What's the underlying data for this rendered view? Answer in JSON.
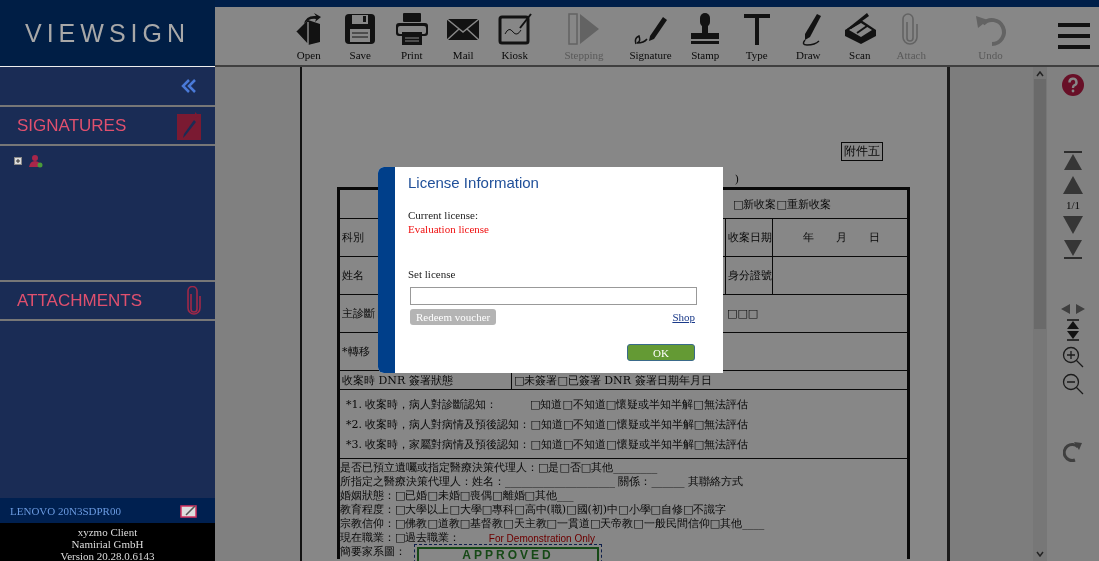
{
  "logo": {
    "text": "VIEWSIGN"
  },
  "sidebar": {
    "sections": [
      {
        "kind": "signatures",
        "title": "SIGNATURES"
      },
      {
        "kind": "attachments",
        "title": "ATTACHMENTS"
      }
    ],
    "tree": [
      {
        "expanded": false
      }
    ],
    "device": "LENOVO 20N3SDPR00",
    "footer": [
      "xyzmo Client",
      "Namirial GmbH",
      "Version 20.28.0.6143"
    ]
  },
  "toolbar": [
    {
      "kind": "open",
      "label": "Open",
      "disabled": false
    },
    {
      "kind": "save",
      "label": "Save",
      "disabled": false
    },
    {
      "kind": "print",
      "label": "Print",
      "disabled": false
    },
    {
      "kind": "mail",
      "label": "Mail",
      "disabled": false
    },
    {
      "kind": "kiosk",
      "label": "Kiosk",
      "disabled": false
    },
    {
      "kind": "stepping",
      "label": "Stepping",
      "disabled": true
    },
    {
      "kind": "signature",
      "label": "Signature",
      "disabled": false
    },
    {
      "kind": "stamp",
      "label": "Stamp",
      "disabled": false
    },
    {
      "kind": "type",
      "label": "Type",
      "disabled": false
    },
    {
      "kind": "draw",
      "label": "Draw",
      "disabled": false
    },
    {
      "kind": "scan",
      "label": "Scan",
      "disabled": false
    },
    {
      "kind": "attach",
      "label": "Attach",
      "disabled": true
    },
    {
      "kind": "undo",
      "label": "Undo",
      "disabled": true
    }
  ],
  "pager": {
    "page": "1/1"
  },
  "document": {
    "tag": "附件五",
    "title_tail": ")",
    "header_rows": [
      {
        "label": "",
        "right_label": "",
        "right_value": "□新收案□重新收案"
      },
      {
        "label": "科別",
        "right_label": "收案日期",
        "right_value": "年　　月　　日"
      },
      {
        "label": "姓名",
        "right_label": "身分證號",
        "right_value": ""
      },
      {
        "label": "主診斷",
        "right_label": "",
        "right_value": "□□□"
      },
      {
        "label": "*轉移",
        "right_label": "",
        "right_value": ""
      }
    ],
    "dnr": {
      "label": "收案時 DNR 簽署狀態",
      "value": "□未簽署□已簽署 DNR 簽署日期年月日"
    },
    "questions": [
      {
        "text": "*1. 收案時，病人對診斷認知：",
        "options": "□知道□不知道□懷疑或半知半解□無法評估"
      },
      {
        "text": "*2. 收案時，病人對病情及預後認知：",
        "options": "□知道□不知道□懷疑或半知半解□無法評估"
      },
      {
        "text": "*3. 收案時，家屬對病情及預後認知：",
        "options": "□知道□不知道□懷疑或半知半解□無法評估"
      }
    ],
    "lines": [
      "是否已預立遺囑或指定醫療決策代理人：□是□否□其他________",
      "所指定之醫療決策代理人：姓名：____________________ 關係：______ 其聯絡方式",
      "婚姻狀態：□已婚□未婚□喪偶□離婚□其他___",
      "教育程度：□大學以上□大學□專科□高中(職)□國(初)中□小學□自修□不識字",
      "宗教信仰：□佛教□道教□基督教□天主教□一貫道□天帝教□一般民間信仰□其他____",
      "現在職業：□過去職業：",
      "簡要家系圖："
    ],
    "stamp": {
      "note": "For Demonstration Only",
      "text": "APPROVED"
    }
  },
  "dialog": {
    "title": "License Information",
    "current_label": "Current license:",
    "current_value": "Evaluation license",
    "set_label": "Set license",
    "redeem": {
      "label": "Redeem voucher",
      "disabled": true
    },
    "shop": "Shop",
    "ok": "OK"
  }
}
